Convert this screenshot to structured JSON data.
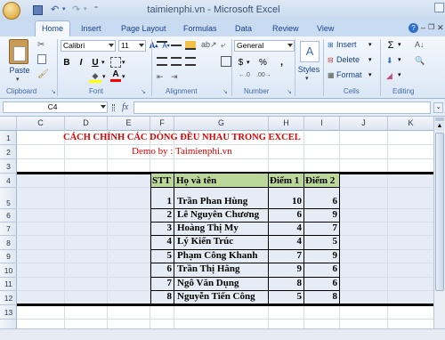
{
  "window": {
    "title": "taimienphi.vn - Microsoft Excel"
  },
  "ribbon_tabs": [
    "Home",
    "Insert",
    "Page Layout",
    "Formulas",
    "Data",
    "Review",
    "View"
  ],
  "font": {
    "name": "Calibri",
    "size": "11"
  },
  "number": {
    "format": "General"
  },
  "labels": {
    "paste": "Paste",
    "styles": "Styles",
    "insert": "Insert",
    "delete": "Delete",
    "format": "Format",
    "clipboard": "Clipboard",
    "font": "Font",
    "alignment": "Alignment",
    "number": "Number",
    "cells": "Cells",
    "editing": "Editing",
    "sigma": "Σ",
    "currency": "$",
    "percent": "%",
    "comma": ","
  },
  "name_box": "C4",
  "formula_label": "fx",
  "columns": [
    "C",
    "D",
    "E",
    "F",
    "G",
    "H",
    "I",
    "J",
    "K"
  ],
  "rows": [
    "1",
    "2",
    "3",
    "4",
    "5",
    "6",
    "7",
    "8",
    "9",
    "10",
    "11",
    "12",
    "13"
  ],
  "sheet": {
    "title": "CÁCH CHỈNH CÁC DÒNG ĐỀU NHAU TRONG EXCEL",
    "demo": "Demo by : Taimienphi.vn",
    "headers": {
      "stt": "STT",
      "name": "Họ và tên",
      "score1": "Điểm 1",
      "score2": "Điểm 2"
    },
    "students": [
      {
        "stt": "1",
        "name": "Trần Phan Hùng",
        "s1": "10",
        "s2": "6"
      },
      {
        "stt": "2",
        "name": "Lê Nguyên Chương",
        "s1": "6",
        "s2": "9"
      },
      {
        "stt": "3",
        "name": "Hoàng Thị My",
        "s1": "4",
        "s2": "7"
      },
      {
        "stt": "4",
        "name": "Lý Kiến Trúc",
        "s1": "4",
        "s2": "5"
      },
      {
        "stt": "5",
        "name": "Phạm Công Khanh",
        "s1": "7",
        "s2": "9"
      },
      {
        "stt": "6",
        "name": "Trần Thị Hằng",
        "s1": "9",
        "s2": "6"
      },
      {
        "stt": "7",
        "name": "Ngô Văn Dụng",
        "s1": "8",
        "s2": "6"
      },
      {
        "stt": "8",
        "name": "Nguyễn Tiến Công",
        "s1": "5",
        "s2": "8"
      }
    ]
  },
  "colors": {
    "title": "#e00000",
    "demo": "#e00000",
    "header_fill": "#bcd79a",
    "selection": "#e6ecf6"
  }
}
